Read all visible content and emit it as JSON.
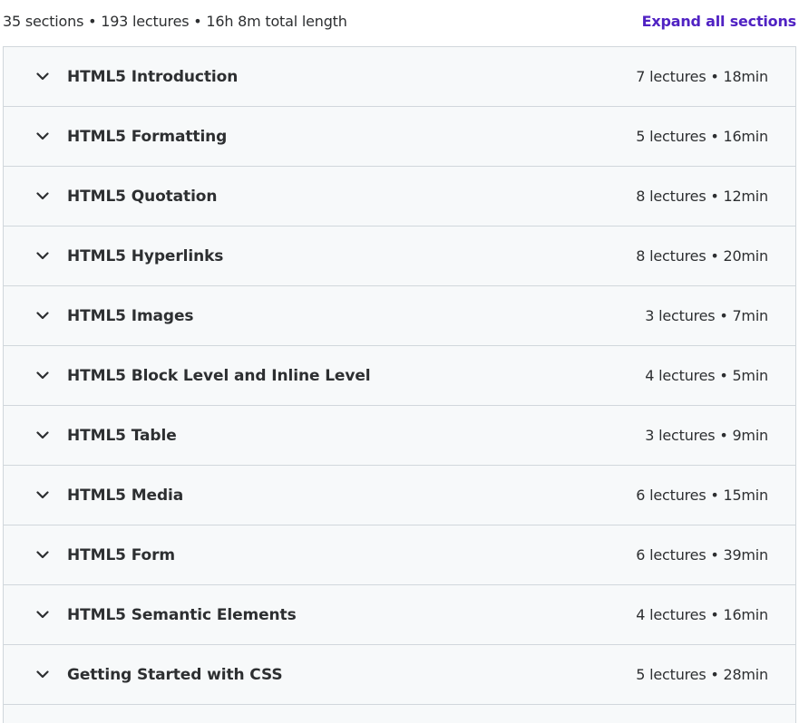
{
  "summary": {
    "text": "35 sections • 193 lectures • 16h 8m total length",
    "expand_label": "Expand all sections"
  },
  "colors": {
    "accent": "#5022c3",
    "row_bg": "#f7f9fa",
    "border": "#d1d7dc",
    "text": "#2d2f31"
  },
  "icons": {
    "section_toggle": "chevron-down-icon"
  },
  "sections": [
    {
      "title": "HTML5 Introduction",
      "meta": "7 lectures • 18min"
    },
    {
      "title": "HTML5 Formatting",
      "meta": "5 lectures • 16min"
    },
    {
      "title": "HTML5 Quotation",
      "meta": "8 lectures • 12min"
    },
    {
      "title": "HTML5 Hyperlinks",
      "meta": "8 lectures • 20min"
    },
    {
      "title": "HTML5 Images",
      "meta": "3 lectures • 7min"
    },
    {
      "title": "HTML5 Block Level and Inline Level",
      "meta": "4 lectures • 5min"
    },
    {
      "title": "HTML5 Table",
      "meta": "3 lectures • 9min"
    },
    {
      "title": "HTML5 Media",
      "meta": "6 lectures • 15min"
    },
    {
      "title": "HTML5 Form",
      "meta": "6 lectures • 39min"
    },
    {
      "title": "HTML5 Semantic Elements",
      "meta": "4 lectures • 16min"
    },
    {
      "title": "Getting Started with CSS",
      "meta": "5 lectures • 28min"
    }
  ]
}
